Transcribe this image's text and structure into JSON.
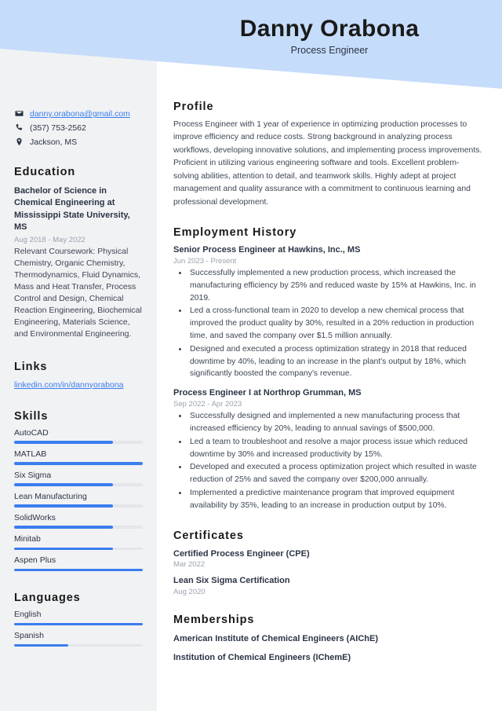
{
  "theme": {
    "banner_color": "#c5dcfa",
    "sidebar_color": "#f1f2f4",
    "accent_color": "#3b7ded",
    "text_color": "#2b3445",
    "muted_color": "#9aa1ad"
  },
  "header": {
    "name": "Danny Orabona",
    "title": "Process Engineer"
  },
  "contact": {
    "email": "danny.orabona@gmail.com",
    "phone": "(357) 753-2562",
    "location": "Jackson, MS"
  },
  "sidebar": {
    "education": {
      "heading": "Education",
      "degree": "Bachelor of Science in Chemical Engineering at Mississippi State University, MS",
      "dates": "Aug 2018 - May 2022",
      "description": "Relevant Coursework: Physical Chemistry, Organic Chemistry, Thermodynamics, Fluid Dynamics, Mass and Heat Transfer, Process Control and Design, Chemical Reaction Engineering, Biochemical Engineering, Materials Science, and Environmental Engineering."
    },
    "links": {
      "heading": "Links",
      "items": [
        {
          "label": "linkedin.com/in/dannyorabona"
        }
      ]
    },
    "skills": {
      "heading": "Skills",
      "items": [
        {
          "label": "AutoCAD",
          "level": 77
        },
        {
          "label": "MATLAB",
          "level": 100
        },
        {
          "label": "Six Sigma",
          "level": 77
        },
        {
          "label": "Lean Manufacturing",
          "level": 77
        },
        {
          "label": "SolidWorks",
          "level": 77
        },
        {
          "label": "Minitab",
          "level": 77
        },
        {
          "label": "Aspen Plus",
          "level": 100
        }
      ]
    },
    "languages": {
      "heading": "Languages",
      "items": [
        {
          "label": "English",
          "level": 100
        },
        {
          "label": "Spanish",
          "level": 42
        }
      ]
    }
  },
  "main": {
    "profile": {
      "heading": "Profile",
      "text": "Process Engineer with 1 year of experience in optimizing production processes to improve efficiency and reduce costs. Strong background in analyzing process workflows, developing innovative solutions, and implementing process improvements. Proficient in utilizing various engineering software and tools. Excellent problem-solving abilities, attention to detail, and teamwork skills. Highly adept at project management and quality assurance with a commitment to continuous learning and professional development."
    },
    "employment": {
      "heading": "Employment History",
      "jobs": [
        {
          "title": "Senior Process Engineer at Hawkins, Inc., MS",
          "dates": "Jun 2023 - Present",
          "bullets": [
            "Successfully implemented a new production process, which increased the manufacturing efficiency by 25% and reduced waste by 15% at Hawkins, Inc. in 2019.",
            "Led a cross-functional team in 2020 to develop a new chemical process that improved the product quality by 30%, resulted in a 20% reduction in production time, and saved the company over $1.5 million annually.",
            "Designed and executed a process optimization strategy in 2018 that reduced downtime by 40%, leading to an increase in the plant's output by 18%, which significantly boosted the company's revenue."
          ]
        },
        {
          "title": "Process Engineer I at Northrop Grumman, MS",
          "dates": "Sep 2022 - Apr 2023",
          "bullets": [
            "Successfully designed and implemented a new manufacturing process that increased efficiency by 20%, leading to annual savings of $500,000.",
            "Led a team to troubleshoot and resolve a major process issue which reduced downtime by 30% and increased productivity by 15%.",
            "Developed and executed a process optimization project which resulted in waste reduction of 25% and saved the company over $200,000 annually.",
            "Implemented a predictive maintenance program that improved equipment availability by 35%, leading to an increase in production output by 10%."
          ]
        }
      ]
    },
    "certificates": {
      "heading": "Certificates",
      "items": [
        {
          "name": "Certified Process Engineer (CPE)",
          "date": "Mar 2022"
        },
        {
          "name": "Lean Six Sigma Certification",
          "date": "Aug 2020"
        }
      ]
    },
    "memberships": {
      "heading": "Memberships",
      "items": [
        {
          "name": "American Institute of Chemical Engineers (AIChE)"
        },
        {
          "name": "Institution of Chemical Engineers (IChemE)"
        }
      ]
    }
  }
}
